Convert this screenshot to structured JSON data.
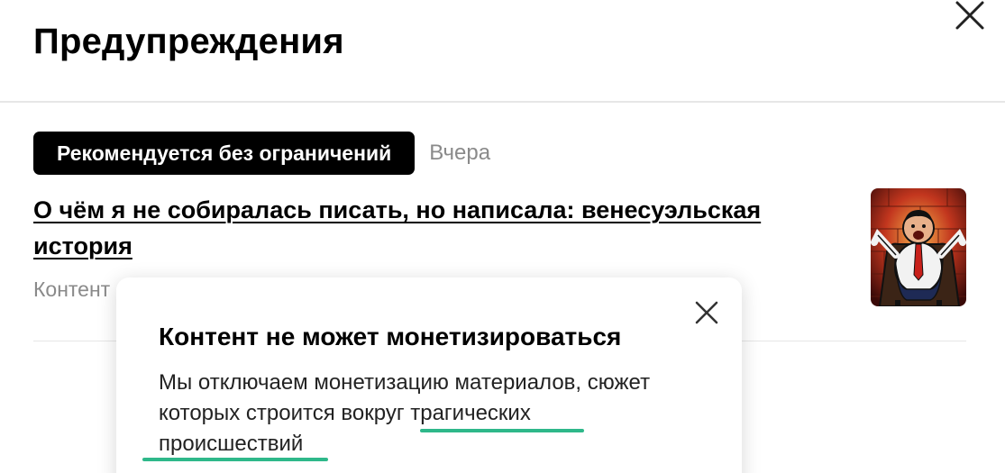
{
  "header": {
    "title": "Предупреждения",
    "close_icon": "close-icon"
  },
  "warning": {
    "badge": "Рекомендуется без ограничений",
    "date": "Вчера",
    "article_title": "О чём я не собиралась писать, но написала: венесуэльская история",
    "subtitle": "Контент",
    "thumbnail_icon": "article-thumbnail"
  },
  "tooltip": {
    "title": "Контент не может монетизироваться",
    "body_line1": "Мы отключаем монетизацию материалов, сюжет",
    "body_line2": "которых строится вокруг трагических",
    "body_line3": "происшествий",
    "close_icon": "close-icon"
  },
  "colors": {
    "badge_bg": "#000000",
    "badge_text": "#ffffff",
    "muted_text": "#8a8a8a",
    "highlight": "#2eb88a"
  }
}
